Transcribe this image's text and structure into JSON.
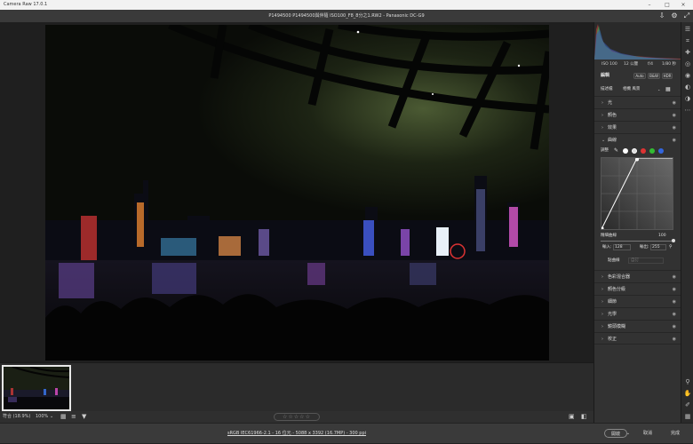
{
  "window": {
    "title": "Camera Raw 17.0.1",
    "minimize": "–",
    "maximize": "□",
    "close": "×"
  },
  "filebar": {
    "filename": "P1494500 P1494500與伴隨 ISO100_F8_8分之1.RW2  -  Panasonic DC-G9"
  },
  "filmstrip": {
    "zoom_label": "符合 (18.9%)",
    "zoom_value": "100%",
    "stars": "☆☆☆☆☆"
  },
  "footer": {
    "info": "sRGB IEC61966-2.1 - 16 位元 - 5088 x 3392 (16.7MP) - 300 ppi",
    "open_button": "開啟",
    "cancel_button": "取消",
    "done_button": "完成"
  },
  "panel": {
    "exif": {
      "iso": "ISO 100",
      "focal": "12 公釐",
      "aperture": "f/4",
      "shutter": "1/80 秒"
    },
    "edit_title": "編輯",
    "auto_label": "Auto",
    "bw_label": "B&W",
    "hdr_label": "HDR",
    "profile_label": "描述檔",
    "profile_value": "相機 風景",
    "sections_top": [
      {
        "label": "光",
        "expanded": false
      },
      {
        "label": "顏色",
        "expanded": false
      },
      {
        "label": "效果",
        "expanded": false
      },
      {
        "label": "曲線",
        "expanded": true
      }
    ],
    "curve": {
      "adjust_label": "調整",
      "refine_label": "精細曲線",
      "refine_value": "100",
      "input_label": "輸入:",
      "input_value": "128",
      "output_label": "輸出:",
      "output_value": "255",
      "channel_label": "點曲線",
      "channel_value": "自訂"
    },
    "sections_bottom": [
      {
        "label": "色彩混合器"
      },
      {
        "label": "顏色分級"
      },
      {
        "label": "細節"
      },
      {
        "label": "光學"
      },
      {
        "label": "鏡頭模糊"
      },
      {
        "label": "校正"
      }
    ]
  }
}
